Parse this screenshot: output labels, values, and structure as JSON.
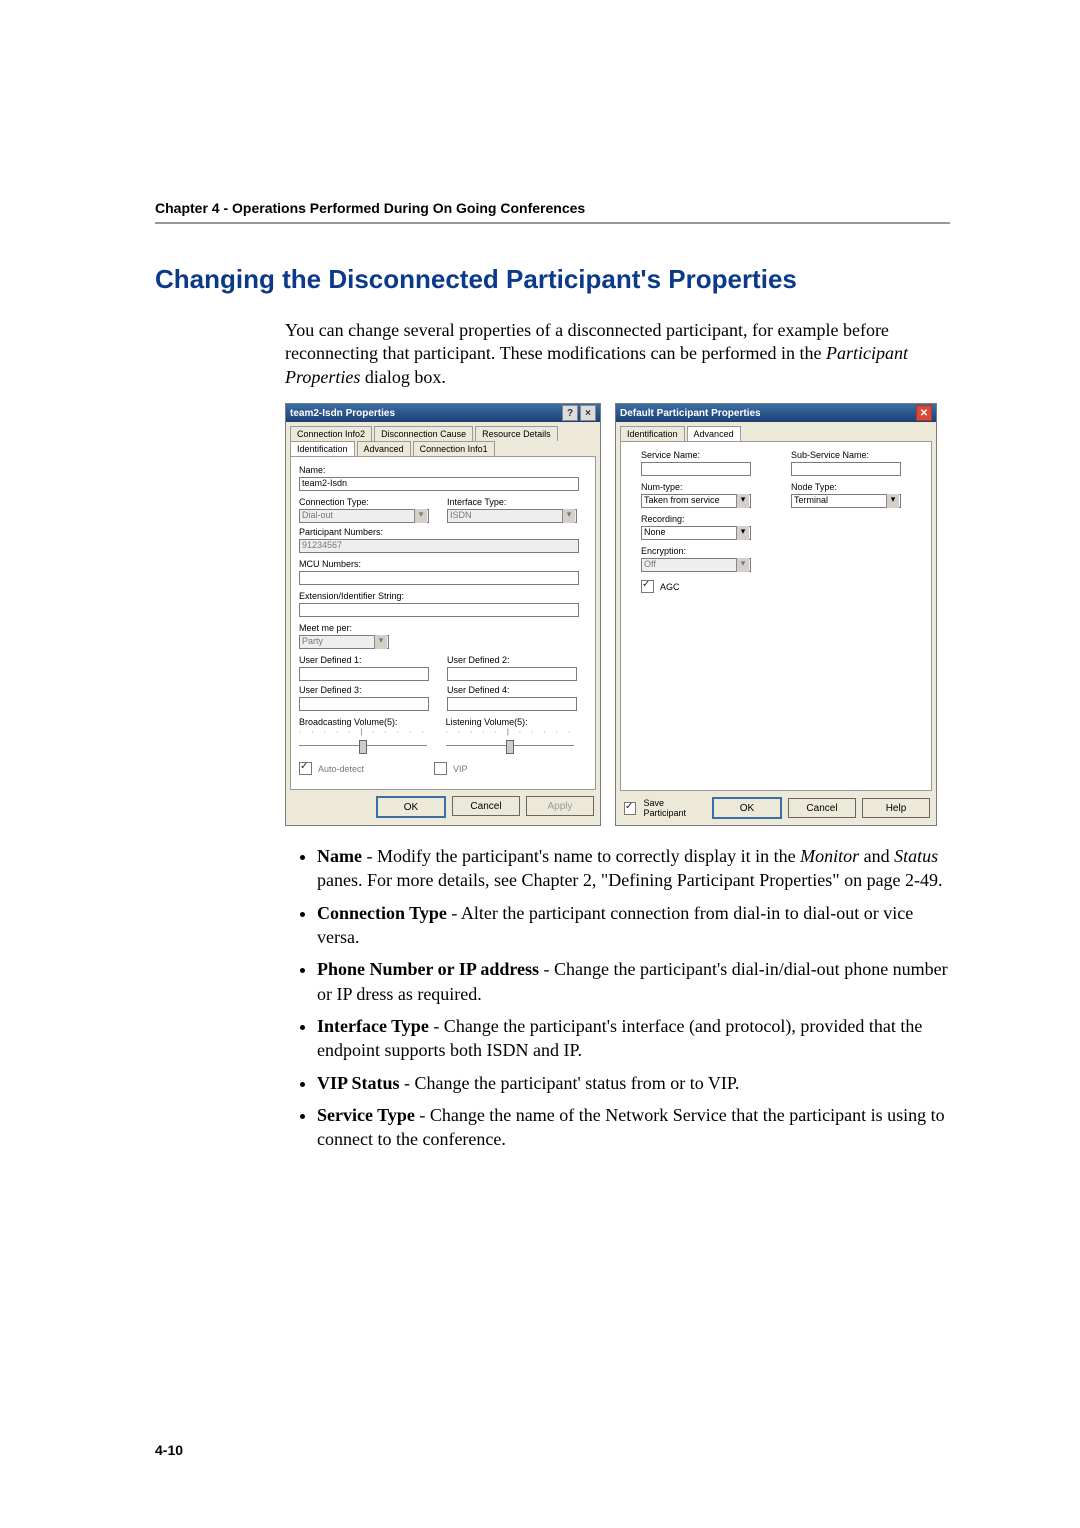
{
  "chapter_header": "Chapter 4 - Operations Performed During On Going Conferences",
  "section_title": "Changing the Disconnected Participant's Properties",
  "intro": {
    "p1_a": "You can change several properties of a disconnected participant, for example before reconnecting that participant. These modifications can be performed in the ",
    "p1_em": "Participant Properties",
    "p1_b": " dialog box."
  },
  "dlg_left": {
    "title": "team2-Isdn Properties",
    "tabs_row1": [
      "Connection Info2",
      "Disconnection Cause",
      "Resource Details"
    ],
    "tabs_row2": [
      "Identification",
      "Advanced",
      "Connection Info1"
    ],
    "labels": {
      "name": "Name:",
      "name_val": "team2-Isdn",
      "conn_type": "Connection Type:",
      "conn_type_val": "Dial-out",
      "intf_type": "Interface Type:",
      "intf_type_val": "ISDN",
      "part_nums": "Participant Numbers:",
      "part_nums_val": "91234567",
      "mcu_nums": "MCU Numbers:",
      "ext_id": "Extension/Identifier String:",
      "meet_me": "Meet me per:",
      "meet_me_val": "Party",
      "ud1": "User Defined 1:",
      "ud2": "User Defined 2:",
      "ud3": "User Defined 3:",
      "ud4": "User Defined 4:",
      "bvol": "Broadcasting Volume(5):",
      "lvol": "Listening Volume(5):",
      "auto_pu": "Auto-detect",
      "vip": "VIP"
    },
    "buttons": {
      "ok": "OK",
      "cancel": "Cancel",
      "apply": "Apply"
    }
  },
  "dlg_right": {
    "title": "Default Participant Properties",
    "tabs": [
      "Identification",
      "Advanced"
    ],
    "labels": {
      "service_name": "Service Name:",
      "sub_service": "Sub-Service Name:",
      "num_type": "Num-type:",
      "num_type_val": "Taken from service",
      "node_type": "Node Type:",
      "node_type_val": "Terminal",
      "recording": "Recording:",
      "recording_val": "None",
      "encryption": "Encryption:",
      "encryption_val": "Off",
      "agc": "AGC"
    },
    "save_part": "Save Participant",
    "buttons": {
      "ok": "OK",
      "cancel": "Cancel",
      "help": "Help"
    }
  },
  "bullets": [
    {
      "term": "Name",
      "rest_a": " - Modify the participant's name to correctly display it in the ",
      "em1": "Monitor",
      "mid": " and ",
      "em2": "Status",
      "rest_b": " panes. For more details, see Chapter 2, \"Defining Participant Properties\" on page 2-49."
    },
    {
      "term": "Connection Type",
      "rest": " - Alter the participant connection from dial-in to dial-out or vice versa."
    },
    {
      "term": "Phone Number or IP address",
      "rest": " - Change the participant's dial-in/dial-out phone number or IP dress as required."
    },
    {
      "term": "Interface Type",
      "rest": " - Change the participant's interface (and protocol), provided that the endpoint supports both ISDN and IP."
    },
    {
      "term": "VIP Status",
      "rest": " - Change the participant' status from or to VIP."
    },
    {
      "term": "Service Type",
      "rest": " - Change the name of the Network Service that the participant is using to connect to the conference."
    }
  ],
  "page_num": "4-10"
}
